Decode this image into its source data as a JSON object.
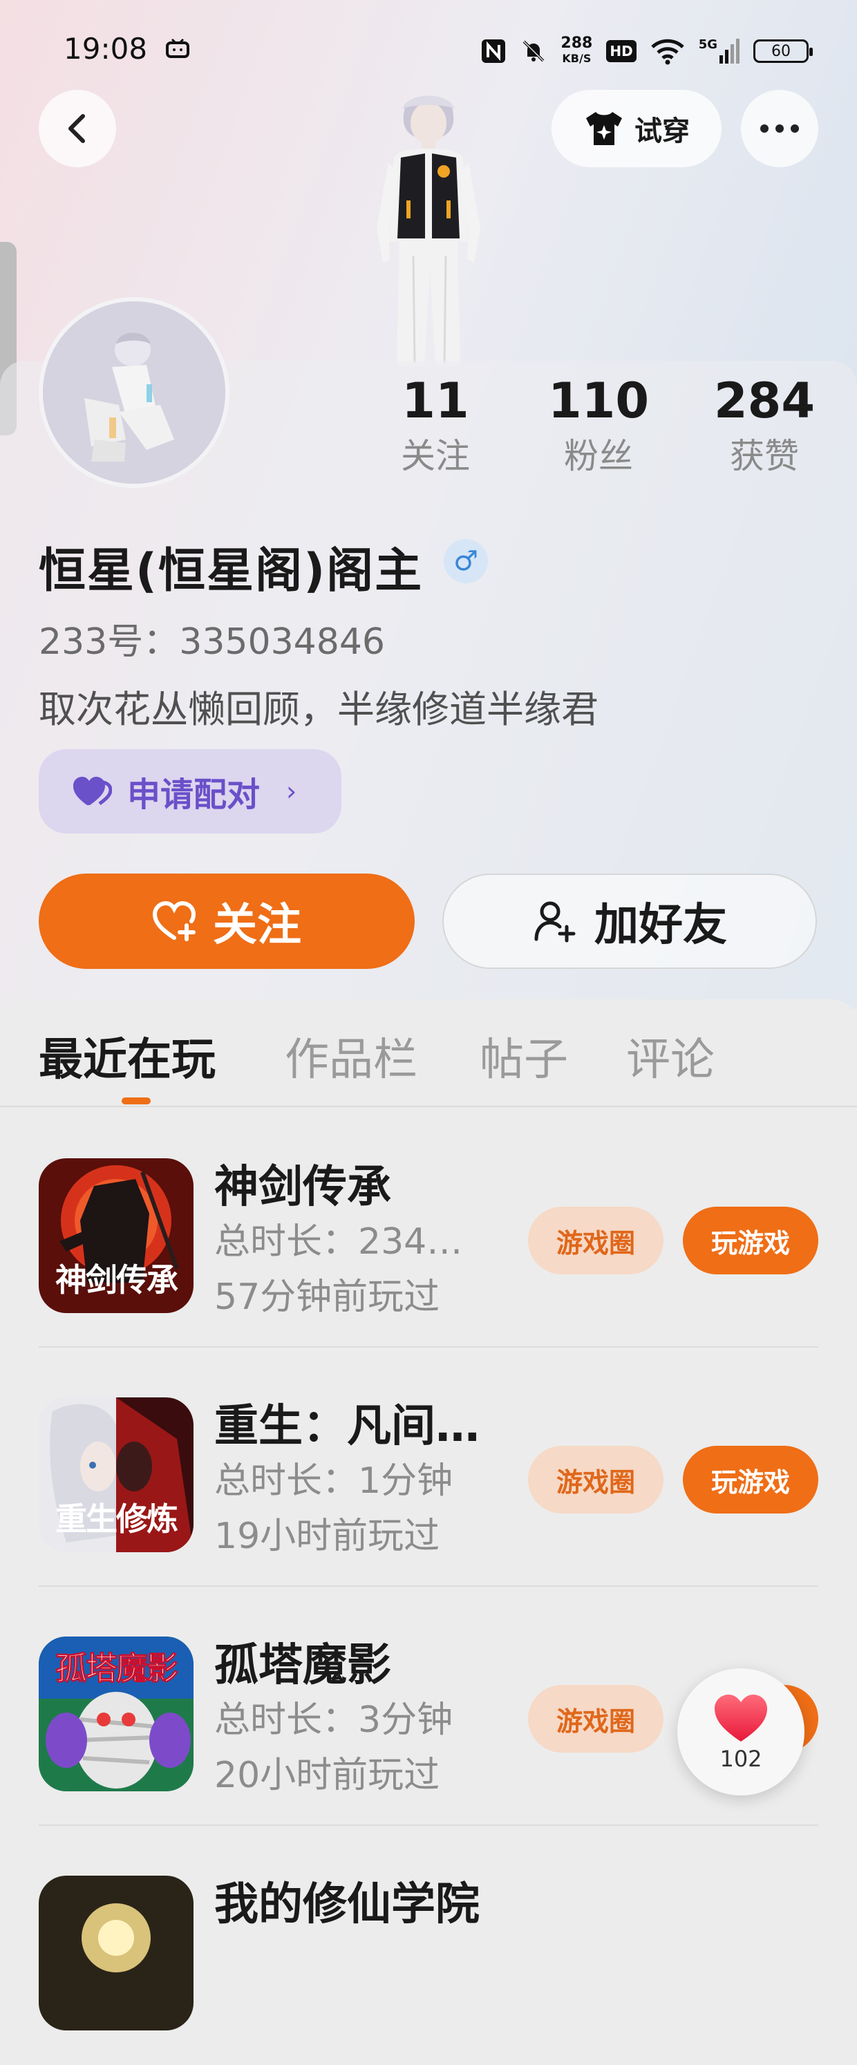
{
  "status_bar": {
    "time": "19:08",
    "net_speed_value": "288",
    "net_speed_unit": "KB/S",
    "hd": "HD",
    "signal": "5G",
    "battery": "60"
  },
  "header": {
    "tryon_label": "试穿"
  },
  "stats": [
    {
      "value": "11",
      "label": "关注"
    },
    {
      "value": "110",
      "label": "粉丝"
    },
    {
      "value": "284",
      "label": "获赞"
    }
  ],
  "profile": {
    "name": "恒星(恒星阁)阁主",
    "gender_symbol": "♂",
    "uid": "233号：335034846",
    "bio": "取次花丛懒回顾，半缘修道半缘君",
    "pair_label": "申请配对"
  },
  "actions": {
    "follow_label": "关注",
    "add_friend_label": "加好友"
  },
  "tabs": [
    {
      "label": "最近在玩",
      "active": true
    },
    {
      "label": "作品栏",
      "active": false
    },
    {
      "label": "帖子",
      "active": false
    },
    {
      "label": "评论",
      "active": false
    }
  ],
  "games": [
    {
      "title": "神剑传承",
      "icon_caption": "神剑传承",
      "duration": "总时长：234…",
      "last_played": "57分钟前玩过",
      "circle_label": "游戏圈",
      "play_label": "玩游戏"
    },
    {
      "title": "重生：凡间…",
      "icon_caption": "重生修炼",
      "duration": "总时长：1分钟",
      "last_played": "19小时前玩过",
      "circle_label": "游戏圈",
      "play_label": "玩游戏"
    },
    {
      "title": "孤塔魔影",
      "icon_caption": "孤塔魔影",
      "duration": "总时长：3分钟",
      "last_played": "20小时前玩过",
      "circle_label": "游戏圈",
      "play_label": "玩游戏"
    },
    {
      "title": "我的修仙学院",
      "icon_caption": "",
      "duration": "",
      "last_played": "",
      "circle_label": "",
      "play_label": ""
    }
  ],
  "like_fab": {
    "count": "102"
  },
  "colors": {
    "accent": "#ef6e16",
    "pair_text": "#6a50c9",
    "gender": "#3a86d6"
  }
}
